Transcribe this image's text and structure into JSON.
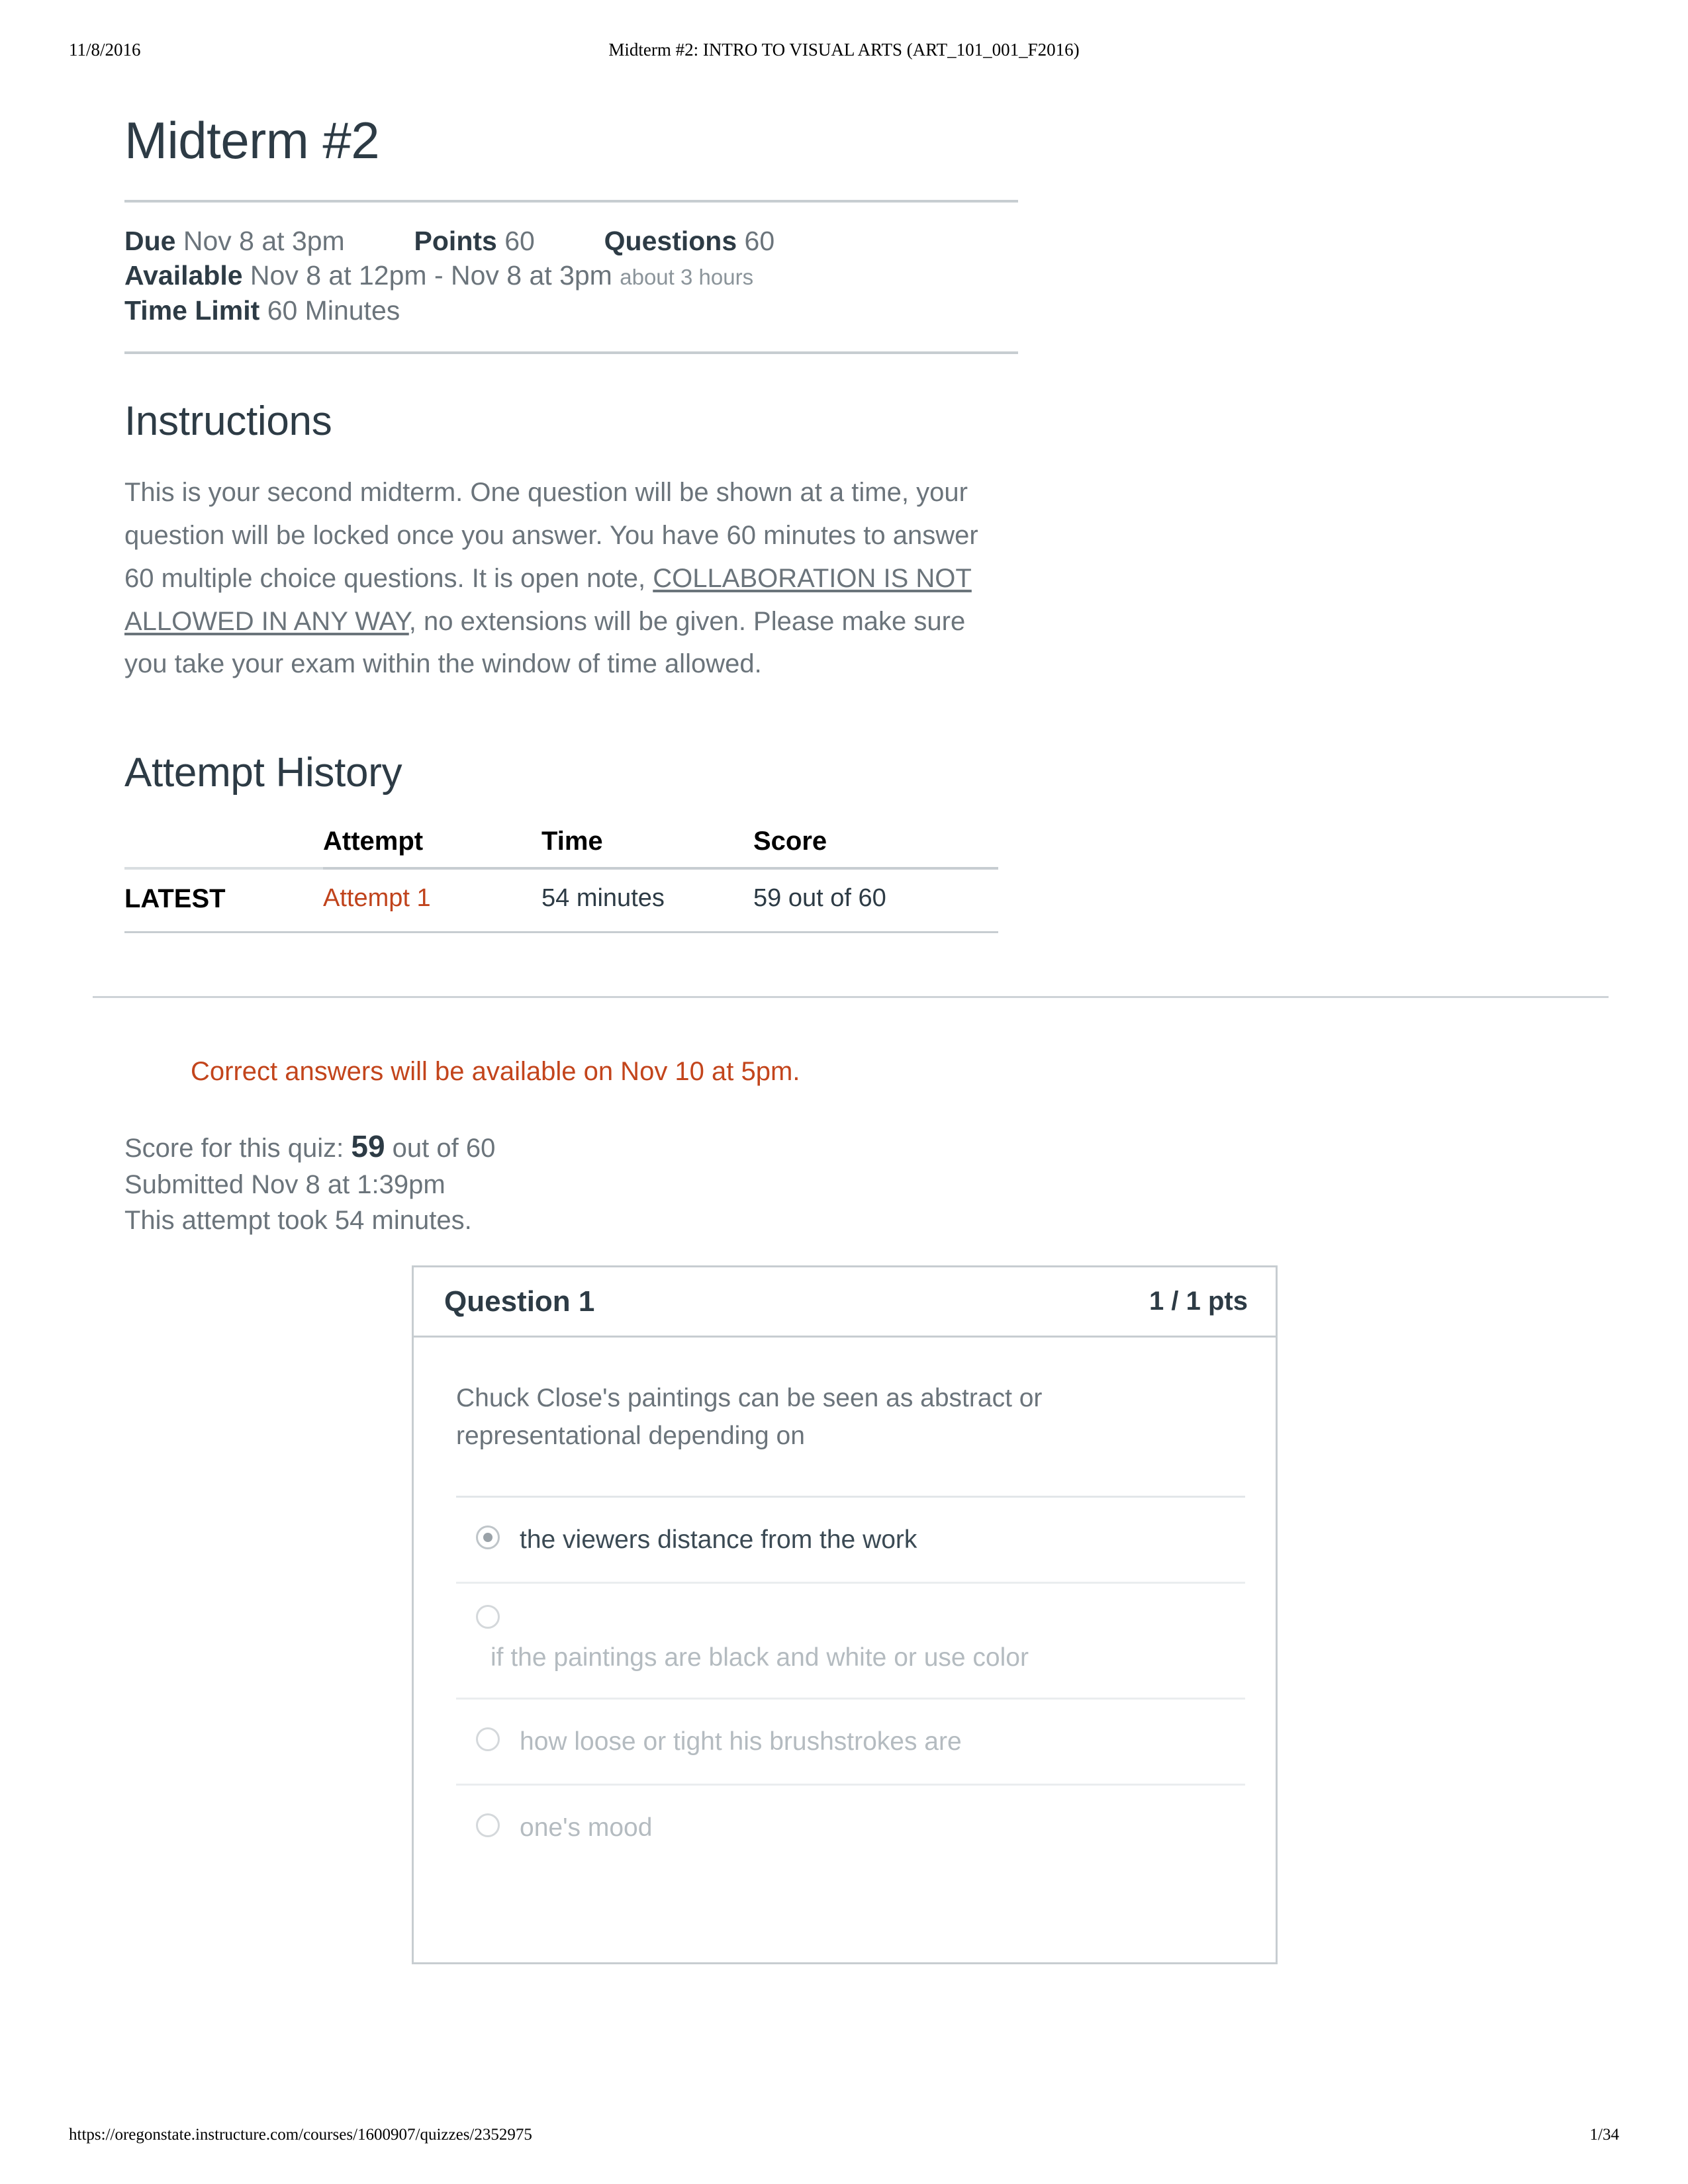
{
  "print": {
    "date": "11/8/2016",
    "doc_title": "Midterm #2: INTRO TO VISUAL ARTS (ART_101_001_F2016)",
    "url": "https://oregonstate.instructure.com/courses/1600907/quizzes/2352975",
    "page": "1/34"
  },
  "quiz": {
    "title": "Midterm #2",
    "due_label": "Due",
    "due_value": "Nov 8 at 3pm",
    "points_label": "Points",
    "points_value": "60",
    "questions_label": "Questions",
    "questions_value": "60",
    "available_label": "Available",
    "available_value": "Nov 8 at 12pm - Nov 8 at 3pm",
    "available_duration": "about 3 hours",
    "time_limit_label": "Time Limit",
    "time_limit_value": "60 Minutes"
  },
  "instructions": {
    "heading": "Instructions",
    "part1": "This is your second midterm. One question will be shown at a time, your question will be locked once you answer. You have 60 minutes to answer 60 multiple choice questions. It is open note, ",
    "emphasis": "COLLABORATION IS NOT ALLOWED IN ANY WAY",
    "part2": ", no extensions will be given. Please make sure you take your exam within the window of time allowed."
  },
  "attempt_history": {
    "heading": "Attempt History",
    "columns": [
      "",
      "Attempt",
      "Time",
      "Score"
    ],
    "rows": [
      {
        "badge": "LATEST",
        "attempt": "Attempt 1",
        "time": "54 minutes",
        "score": "59 out of 60"
      }
    ]
  },
  "results": {
    "answers_note": "Correct answers will be available on Nov 10 at 5pm.",
    "score_prefix": "Score for this quiz: ",
    "score_value": "59",
    "score_suffix": " out of 60",
    "submitted": "Submitted Nov 8 at 1:39pm",
    "duration": "This attempt took 54 minutes."
  },
  "question": {
    "title": "Question 1",
    "points": "1 / 1 pts",
    "text": "Chuck Close's paintings can be seen as abstract or representational depending on",
    "options": [
      {
        "label": "the viewers distance from the work",
        "selected": true,
        "wrapped": false
      },
      {
        "label": "if the paintings are black and white or use color",
        "selected": false,
        "wrapped": true
      },
      {
        "label": "how loose or tight his brushstrokes are",
        "selected": false,
        "wrapped": false
      },
      {
        "label": "one's mood",
        "selected": false,
        "wrapped": false
      }
    ]
  },
  "colors": {
    "accent_link": "#C0431C",
    "accent_note": "#C3451C",
    "heading": "#2D3B45",
    "body": "#6B747B",
    "muted_option": "#B4BBC0",
    "rule": "#C7CDD1"
  }
}
